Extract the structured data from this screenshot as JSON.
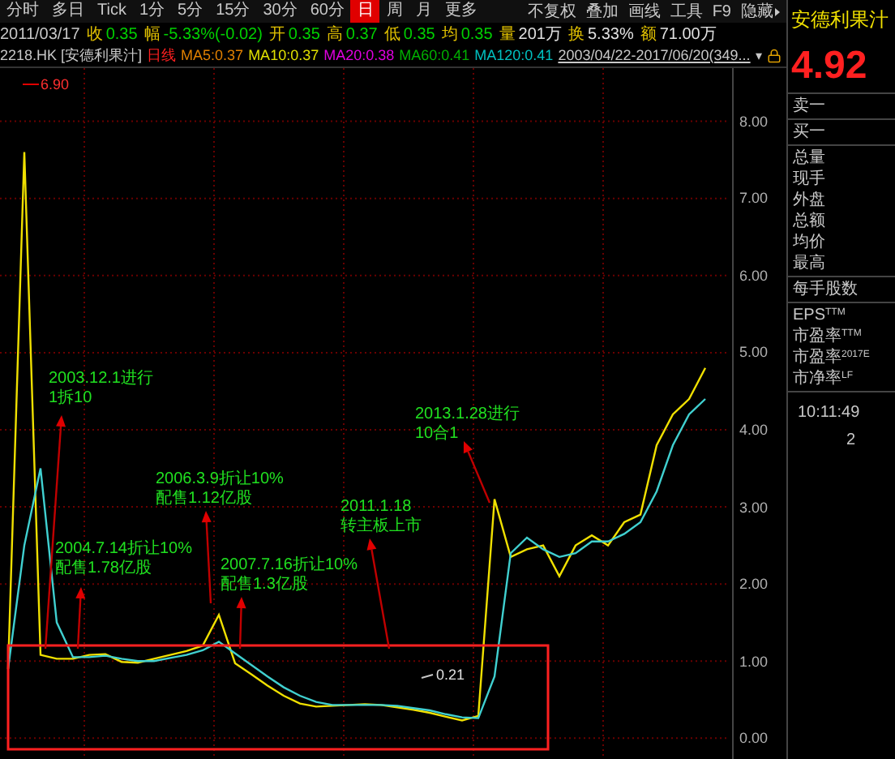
{
  "period_tabs": [
    {
      "label": "分时",
      "selected": false
    },
    {
      "label": "多日",
      "selected": false
    },
    {
      "label": "Tick",
      "selected": false
    },
    {
      "label": "1分",
      "selected": false
    },
    {
      "label": "5分",
      "selected": false
    },
    {
      "label": "15分",
      "selected": false
    },
    {
      "label": "30分",
      "selected": false
    },
    {
      "label": "60分",
      "selected": false
    },
    {
      "label": "日",
      "selected": true
    },
    {
      "label": "周",
      "selected": false
    },
    {
      "label": "月",
      "selected": false
    },
    {
      "label": "更多",
      "selected": false
    }
  ],
  "tools": [
    "不复权",
    "叠加",
    "画线",
    "工具",
    "F9",
    "隐藏"
  ],
  "quote": {
    "date": "2011/03/17",
    "fields": [
      {
        "label": "收",
        "value": "0.35",
        "color": "#00d000"
      },
      {
        "label": "幅",
        "value": "-5.33%(-0.02)",
        "color": "#00d000"
      },
      {
        "label": "开",
        "value": "0.35",
        "color": "#00d000"
      },
      {
        "label": "高",
        "value": "0.37",
        "color": "#00d000"
      },
      {
        "label": "低",
        "value": "0.35",
        "color": "#00d000"
      },
      {
        "label": "均",
        "value": "0.35",
        "color": "#00d000"
      },
      {
        "label": "量",
        "value": "201万",
        "color": "#e0e0e0"
      },
      {
        "label": "换",
        "value": "5.33%",
        "color": "#e0e0e0"
      },
      {
        "label": "额",
        "value": "71.00万",
        "color": "#e0e0e0"
      }
    ]
  },
  "legend": {
    "code": "2218.HK [安德利果汁]",
    "period": "日线",
    "ma": [
      {
        "text": "MA5:0.37",
        "color": "#e08000"
      },
      {
        "text": "MA10:0.37",
        "color": "#e0e000"
      },
      {
        "text": "MA20:0.38",
        "color": "#e000e0"
      },
      {
        "text": "MA60:0.41",
        "color": "#00b000"
      },
      {
        "text": "MA120:0.41",
        "color": "#00c0c0"
      }
    ],
    "range": "2003/04/22-2017/06/20(349...",
    "range_caret": "▾"
  },
  "chart": {
    "high_label": "6.90",
    "low_label": "0.21",
    "chart_data": {
      "type": "line",
      "grid": true,
      "ylim": [
        -0.27,
        8.69
      ],
      "yticks": [
        {
          "value": 8,
          "label": "8.00"
        },
        {
          "value": 7,
          "label": "7.00"
        },
        {
          "value": 6,
          "label": "6.00"
        },
        {
          "value": 5,
          "label": "5.00"
        },
        {
          "value": 4,
          "label": "4.00"
        },
        {
          "value": 3,
          "label": "3.00"
        },
        {
          "value": 2,
          "label": "2.00"
        },
        {
          "value": 1,
          "label": "1.00"
        },
        {
          "value": 0,
          "label": "0.00"
        }
      ],
      "series": [
        {
          "color": "#f0e000",
          "values": [
            0.9,
            7.6,
            1.08,
            1.03,
            1.03,
            1.08,
            1.09,
            0.99,
            0.98,
            1.03,
            1.08,
            1.13,
            1.2,
            1.6,
            0.97,
            0.83,
            0.68,
            0.55,
            0.45,
            0.41,
            0.42,
            0.43,
            0.44,
            0.43,
            0.4,
            0.37,
            0.33,
            0.28,
            0.23,
            0.29,
            3.1,
            2.35,
            2.45,
            2.5,
            2.1,
            2.5,
            2.63,
            2.5,
            2.8,
            2.9,
            3.8,
            4.2,
            4.4,
            4.8
          ]
        },
        {
          "color": "#40d0d0",
          "values": [
            0.9,
            2.5,
            3.5,
            1.5,
            1.05,
            1.05,
            1.07,
            1.03,
            1.0,
            1.0,
            1.04,
            1.08,
            1.14,
            1.25,
            1.1,
            0.95,
            0.8,
            0.66,
            0.55,
            0.47,
            0.43,
            0.43,
            0.43,
            0.43,
            0.42,
            0.39,
            0.36,
            0.31,
            0.27,
            0.26,
            0.8,
            2.4,
            2.6,
            2.45,
            2.35,
            2.4,
            2.55,
            2.55,
            2.65,
            2.8,
            3.2,
            3.8,
            4.2,
            4.4
          ]
        }
      ]
    },
    "annotations": [
      {
        "lines": [
          "2003.12.1进行",
          "1拆10"
        ]
      },
      {
        "lines": [
          "2004.7.14折让10%",
          "配售1.78亿股"
        ]
      },
      {
        "lines": [
          "2006.3.9折让10%",
          "配售1.12亿股"
        ]
      },
      {
        "lines": [
          "2007.7.16折让10%",
          "配售1.3亿股"
        ]
      },
      {
        "lines": [
          "2011.1.18",
          "转主板上市"
        ]
      },
      {
        "lines": [
          "2013.1.28进行",
          "10合1"
        ]
      }
    ]
  },
  "side_panel": {
    "name": "安德利果汁",
    "price": "4.92",
    "groups": [
      [
        "卖一"
      ],
      [
        "买一"
      ],
      [
        "总量",
        "现手",
        "外盘",
        "总额",
        "均价",
        "最高"
      ],
      [
        "每手股数"
      ],
      [
        "EPS$^{TTM}$",
        "市盈率$^{TTM}$",
        "市盈率$^{2017E}$",
        "市净率$^{LF}$"
      ]
    ],
    "time": "10:11:49",
    "count": "2"
  }
}
